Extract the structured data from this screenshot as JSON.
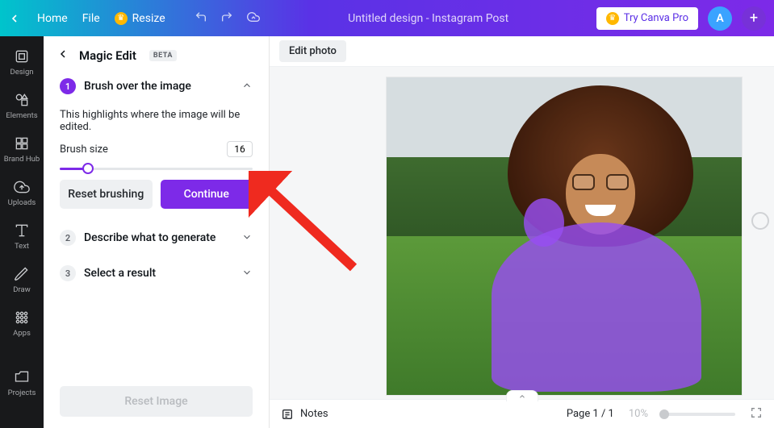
{
  "topbar": {
    "home": "Home",
    "file": "File",
    "resize": "Resize",
    "title": "Untitled design - Instagram Post",
    "try_pro": "Try Canva Pro",
    "avatar_initial": "A"
  },
  "rail": {
    "design": "Design",
    "elements": "Elements",
    "brandhub": "Brand Hub",
    "uploads": "Uploads",
    "text": "Text",
    "draw": "Draw",
    "apps": "Apps",
    "projects": "Projects"
  },
  "panel": {
    "title": "Magic Edit",
    "beta": "BETA",
    "step1_title": "Brush over the image",
    "step1_desc": "This highlights where the image will be edited.",
    "brush_label": "Brush size",
    "brush_value": "16",
    "reset_brush": "Reset brushing",
    "continue": "Continue",
    "step2_title": "Describe what to generate",
    "step3_title": "Select a result",
    "reset_image": "Reset Image"
  },
  "canvas": {
    "edit_photo": "Edit photo"
  },
  "bottombar": {
    "notes": "Notes",
    "page_indicator": "Page 1 / 1",
    "zoom": "10%"
  }
}
